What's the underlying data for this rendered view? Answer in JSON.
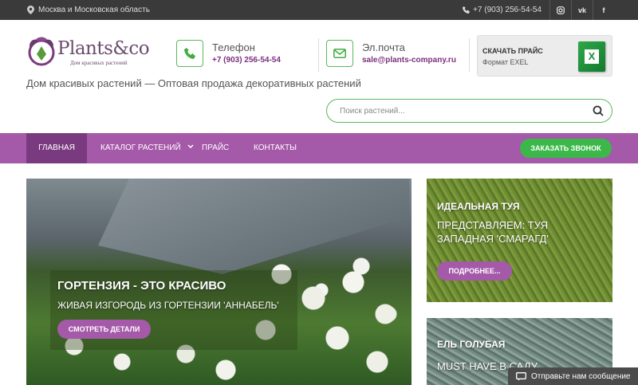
{
  "topbar": {
    "location": "Москва и Московская область",
    "phone": "+7 (903) 256-54-54",
    "social": [
      "instagram-icon",
      "vk-icon",
      "facebook-icon"
    ]
  },
  "header": {
    "logo_text": "Plants&co",
    "logo_sub": "Дом красивых растений",
    "tagline": "Дом красивых растений — Оптовая продажа декоративных растений",
    "phone_label": "Телефон",
    "phone_value": "+7 (903) 256-54-54",
    "email_label": "Эл.почта",
    "email_value": "sale@plants-company.ru",
    "price_title": "СКАЧАТЬ ПРАЙС",
    "price_sub": "Формат EXEL"
  },
  "search": {
    "placeholder": "Поиск растений..."
  },
  "nav": {
    "items": [
      "ГЛАВНАЯ",
      "КАТАЛОГ РАСТЕНИЙ",
      "ПРАЙС",
      "КОНТАКТЫ"
    ],
    "call_button": "ЗАКАЗАТЬ ЗВОНОК"
  },
  "hero": {
    "title": "ГОРТЕНЗИЯ - ЭТО КРАСИВО",
    "subtitle": "ЖИВАЯ ИЗГОРОДЬ ИЗ ГОРТЕНЗИИ 'АННАБЕЛЬ'",
    "button": "СМОТРЕТЬ ДЕТАЛИ"
  },
  "cards": [
    {
      "title": "ИДЕАЛЬНАЯ ТУЯ",
      "text": "ПРЕДСТАВЛЯЕМ: ТУЯ ЗАПАДНАЯ 'СМАРАГД'",
      "button": "ПОДРОБНЕЕ..."
    },
    {
      "title": "ЕЛЬ ГОЛУБАЯ",
      "text": "MUST HAVE В САДУ"
    }
  ],
  "chat": {
    "label": "Отправьте нам сообщение"
  },
  "colors": {
    "accent": "#a459a9",
    "accent_dark": "#7a3a7f",
    "green": "#3cb84a",
    "topbar": "#3a3a3a"
  }
}
